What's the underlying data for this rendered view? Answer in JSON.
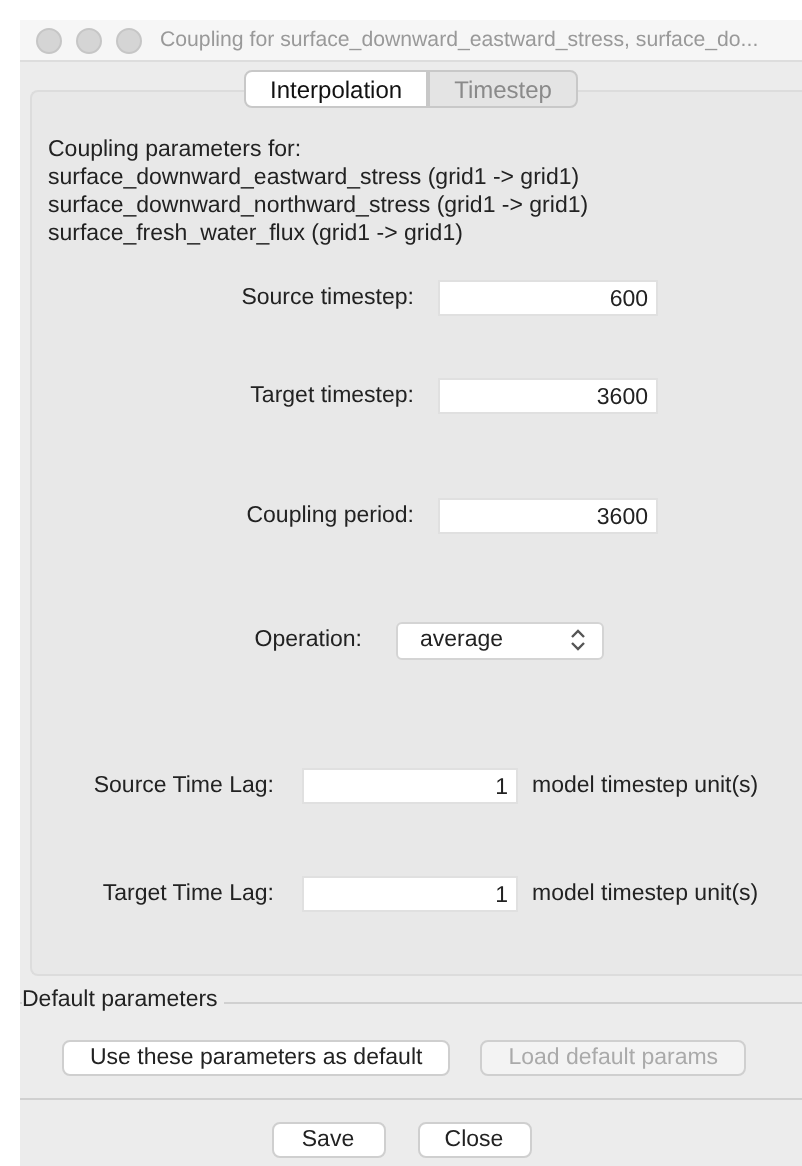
{
  "window": {
    "title": "Coupling for surface_downward_eastward_stress, surface_do..."
  },
  "tabs": [
    {
      "label": "Interpolation",
      "selected": true,
      "disabled": false
    },
    {
      "label": "Timestep",
      "selected": false,
      "disabled": true
    }
  ],
  "intro": [
    "Coupling parameters for:",
    "surface_downward_eastward_stress (grid1 -> grid1)",
    "surface_downward_northward_stress (grid1 -> grid1)",
    "surface_fresh_water_flux (grid1 -> grid1)"
  ],
  "fields": [
    {
      "kind": "text",
      "label": "Source timestep:",
      "value": "600"
    },
    {
      "kind": "text",
      "label": "Target timestep:",
      "value": "3600"
    },
    {
      "kind": "text",
      "label": "Coupling period:",
      "value": "3600"
    },
    {
      "kind": "select",
      "label": "Operation:",
      "value": "average"
    },
    {
      "kind": "lag",
      "label": "Source Time Lag:",
      "value": "1",
      "unit": "model timestep unit(s)"
    },
    {
      "kind": "lag",
      "label": "Target Time Lag:",
      "value": "1",
      "unit": "model timestep unit(s)"
    }
  ],
  "defaults": {
    "legend": "Default parameters",
    "buttons": [
      {
        "label": "Use these parameters as default",
        "disabled": false
      },
      {
        "label": "Load default params",
        "disabled": true
      }
    ]
  },
  "buttons": [
    "Save",
    "Close"
  ]
}
